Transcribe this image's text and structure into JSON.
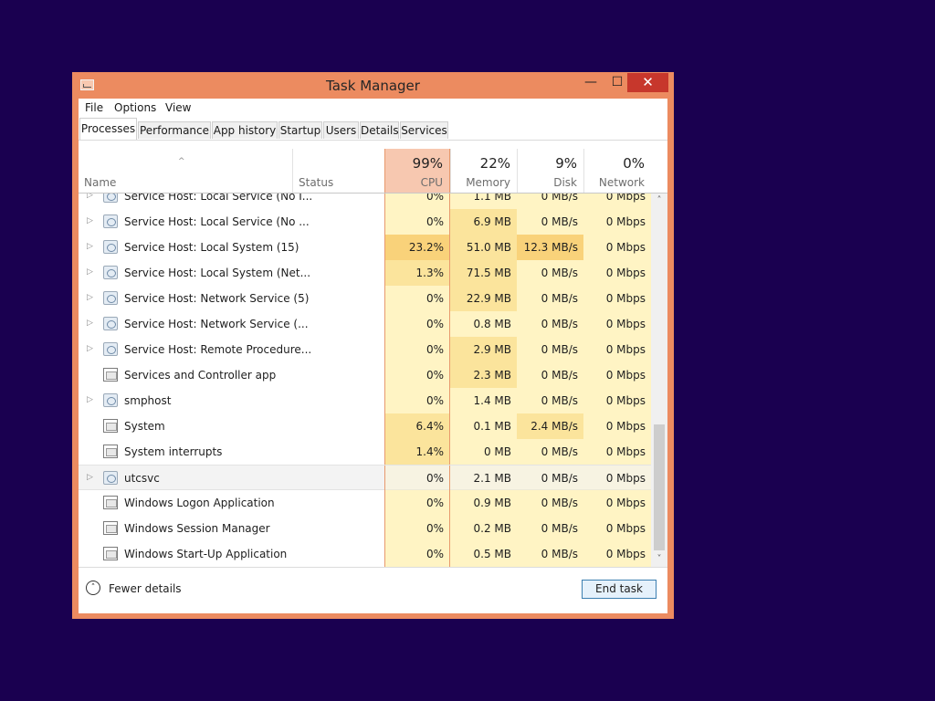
{
  "window": {
    "title": "Task Manager",
    "controls": {
      "minimize": "—",
      "maximize": "☐",
      "close": "✕"
    }
  },
  "menu": [
    "File",
    "Options",
    "View"
  ],
  "tabs": [
    "Processes",
    "Performance",
    "App history",
    "Startup",
    "Users",
    "Details",
    "Services"
  ],
  "active_tab": "Processes",
  "columns": {
    "name": "Name",
    "status": "Status",
    "cpu": {
      "percent": "99%",
      "label": "CPU"
    },
    "memory": {
      "percent": "22%",
      "label": "Memory"
    },
    "disk": {
      "percent": "9%",
      "label": "Disk"
    },
    "network": {
      "percent": "0%",
      "label": "Network"
    }
  },
  "processes": [
    {
      "name": "Service Host: Local Service (No I...",
      "icon": "gear-icon",
      "expandable": true,
      "cpu": "0%",
      "memory": "1.1 MB",
      "disk": "0 MB/s",
      "network": "0 Mbps"
    },
    {
      "name": "Service Host: Local Service (No ...",
      "icon": "gear-icon",
      "expandable": true,
      "cpu": "0%",
      "memory": "6.9 MB",
      "disk": "0 MB/s",
      "network": "0 Mbps"
    },
    {
      "name": "Service Host: Local System (15)",
      "icon": "gear-icon",
      "expandable": true,
      "cpu": "23.2%",
      "memory": "51.0 MB",
      "disk": "12.3 MB/s",
      "network": "0 Mbps"
    },
    {
      "name": "Service Host: Local System (Net...",
      "icon": "gear-icon",
      "expandable": true,
      "cpu": "1.3%",
      "memory": "71.5 MB",
      "disk": "0 MB/s",
      "network": "0 Mbps"
    },
    {
      "name": "Service Host: Network Service (5)",
      "icon": "gear-icon",
      "expandable": true,
      "cpu": "0%",
      "memory": "22.9 MB",
      "disk": "0 MB/s",
      "network": "0 Mbps"
    },
    {
      "name": "Service Host: Network Service (...",
      "icon": "gear-icon",
      "expandable": true,
      "cpu": "0%",
      "memory": "0.8 MB",
      "disk": "0 MB/s",
      "network": "0 Mbps"
    },
    {
      "name": "Service Host: Remote Procedure...",
      "icon": "gear-icon",
      "expandable": true,
      "cpu": "0%",
      "memory": "2.9 MB",
      "disk": "0 MB/s",
      "network": "0 Mbps"
    },
    {
      "name": "Services and Controller app",
      "icon": "app-window-icon",
      "expandable": false,
      "cpu": "0%",
      "memory": "2.3 MB",
      "disk": "0 MB/s",
      "network": "0 Mbps"
    },
    {
      "name": "smphost",
      "icon": "gear-icon",
      "expandable": true,
      "cpu": "0%",
      "memory": "1.4 MB",
      "disk": "0 MB/s",
      "network": "0 Mbps"
    },
    {
      "name": "System",
      "icon": "app-window-icon",
      "expandable": false,
      "cpu": "6.4%",
      "memory": "0.1 MB",
      "disk": "2.4 MB/s",
      "network": "0 Mbps"
    },
    {
      "name": "System interrupts",
      "icon": "app-window-icon",
      "expandable": false,
      "cpu": "1.4%",
      "memory": "0 MB",
      "disk": "0 MB/s",
      "network": "0 Mbps"
    },
    {
      "name": "utcsvc",
      "icon": "gear-icon",
      "expandable": true,
      "cpu": "0%",
      "memory": "2.1 MB",
      "disk": "0 MB/s",
      "network": "0 Mbps",
      "highlighted": true
    },
    {
      "name": "Windows Logon Application",
      "icon": "app-window-icon",
      "expandable": false,
      "cpu": "0%",
      "memory": "0.9 MB",
      "disk": "0 MB/s",
      "network": "0 Mbps"
    },
    {
      "name": "Windows Session Manager",
      "icon": "app-window-icon",
      "expandable": false,
      "cpu": "0%",
      "memory": "0.2 MB",
      "disk": "0 MB/s",
      "network": "0 Mbps"
    },
    {
      "name": "Windows Start-Up Application",
      "icon": "app-window-icon",
      "expandable": false,
      "cpu": "0%",
      "memory": "0.5 MB",
      "disk": "0 MB/s",
      "network": "0 Mbps"
    }
  ],
  "footer": {
    "fewer_details": "Fewer details",
    "end_task": "End task"
  },
  "colors": {
    "desktop": "#1a0050",
    "titlebar": "#ec8b60",
    "close_button": "#c7372c",
    "cell_light": "#fff4c4",
    "cell_medium": "#fbe49c",
    "cell_hot": "#f9d27a",
    "cpu_header": "#f7c8b0"
  }
}
